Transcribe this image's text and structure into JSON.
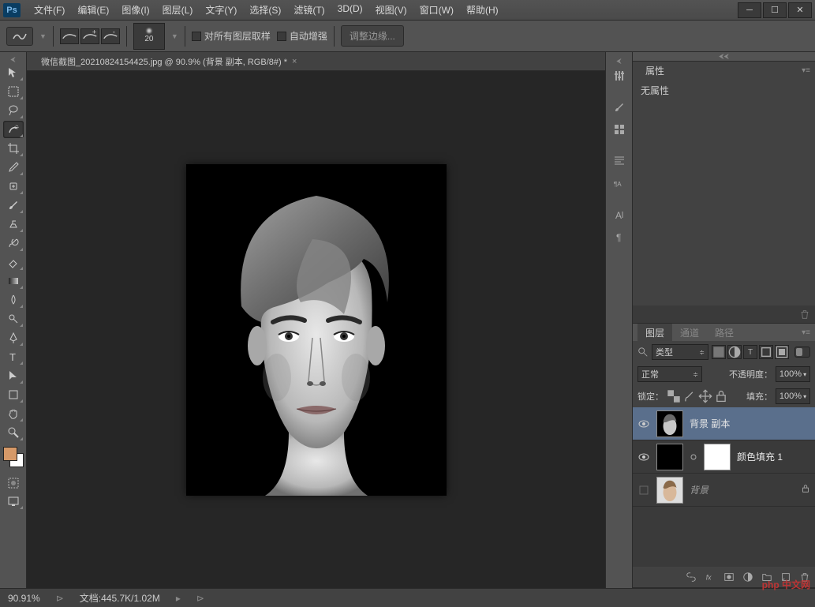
{
  "app": {
    "logo": "Ps"
  },
  "menu": [
    "文件(F)",
    "编辑(E)",
    "图像(I)",
    "图层(L)",
    "文字(Y)",
    "选择(S)",
    "滤镜(T)",
    "3D(D)",
    "视图(V)",
    "窗口(W)",
    "帮助(H)"
  ],
  "options": {
    "brush_size": "20",
    "sample_all_layers": "对所有图层取样",
    "auto_enhance": "自动增强",
    "refine_edge": "调整边缘..."
  },
  "document": {
    "tab_title": "微信截图_20210824154425.jpg @ 90.9% (背景 副本, RGB/8#) *"
  },
  "panels": {
    "properties": {
      "title": "属性",
      "empty_text": "无属性"
    },
    "layers": {
      "tabs": [
        "图层",
        "通道",
        "路径"
      ],
      "kind_label": "类型",
      "blend_mode": "正常",
      "opacity_label": "不透明度：",
      "opacity_value": "100%",
      "lock_label": "锁定：",
      "fill_label": "填充：",
      "fill_value": "100%",
      "items": [
        {
          "name": "背景 副本",
          "visible": true,
          "selected": true
        },
        {
          "name": "颜色填充 1",
          "visible": true,
          "selected": false,
          "is_fill": true
        },
        {
          "name": "背景",
          "visible": false,
          "selected": false,
          "locked": true,
          "dim": true
        }
      ]
    }
  },
  "status": {
    "zoom": "90.91%",
    "doc_info": "文档:445.7K/1.02M"
  },
  "watermark": "php 中文网"
}
